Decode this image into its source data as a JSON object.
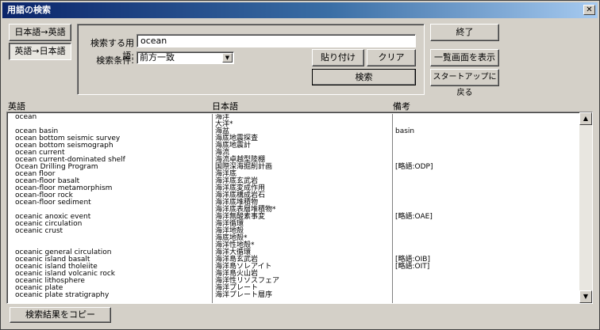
{
  "window": {
    "title": "用語の検索",
    "close_label": "✕"
  },
  "mode_buttons": {
    "ja_to_en": "日本語→英語",
    "en_to_ja": "英語→日本語"
  },
  "search": {
    "term_label": "検索する用語:",
    "term_value": "ocean",
    "condition_label": "検索条件:",
    "condition_value": "前方一致"
  },
  "actions": {
    "paste": "貼り付け",
    "clear": "クリア",
    "search": "検索",
    "exit": "終了",
    "list_view": "一覧画面を表示",
    "back_to_startup": "スタートアップに戻る",
    "copy_results": "検索結果をコピー"
  },
  "columns": {
    "english": "英語",
    "japanese": "日本語",
    "notes": "備考"
  },
  "rows": [
    {
      "en": "ocean",
      "ja": "海洋",
      "note": ""
    },
    {
      "en": "",
      "ja": "大洋*",
      "note": ""
    },
    {
      "en": "ocean basin",
      "ja": "海盆",
      "note": "basin"
    },
    {
      "en": "ocean bottom seismic survey",
      "ja": "海底地震探査",
      "note": ""
    },
    {
      "en": "ocean bottom seismograph",
      "ja": "海底地震計",
      "note": ""
    },
    {
      "en": "ocean current",
      "ja": "海流",
      "note": ""
    },
    {
      "en": "ocean current-dominated shelf",
      "ja": "海流卓越型陸棚",
      "note": ""
    },
    {
      "en": "Ocean Drilling Program",
      "ja": "国際深海掘削計画",
      "note": "[略語:ODP]"
    },
    {
      "en": "ocean floor",
      "ja": "海洋底",
      "note": ""
    },
    {
      "en": "ocean-floor basalt",
      "ja": "海洋底玄武岩",
      "note": ""
    },
    {
      "en": "ocean-floor metamorphism",
      "ja": "海洋底変成作用",
      "note": ""
    },
    {
      "en": "ocean-floor rock",
      "ja": "海洋底構成岩石",
      "note": ""
    },
    {
      "en": "ocean-floor sediment",
      "ja": "海洋底堆積物",
      "note": ""
    },
    {
      "en": "",
      "ja": "海洋底表層堆積物*",
      "note": ""
    },
    {
      "en": "oceanic anoxic event",
      "ja": "海洋無酸素事変",
      "note": "[略語:OAE]"
    },
    {
      "en": "oceanic circulation",
      "ja": "海洋循環",
      "note": ""
    },
    {
      "en": "oceanic crust",
      "ja": "海洋地殻",
      "note": ""
    },
    {
      "en": "",
      "ja": "海底地殻*",
      "note": ""
    },
    {
      "en": "",
      "ja": "海洋性地殻*",
      "note": ""
    },
    {
      "en": "oceanic general circulation",
      "ja": "海洋大循環",
      "note": ""
    },
    {
      "en": "oceanic island basalt",
      "ja": "海洋島玄武岩",
      "note": "[略語:OIB]"
    },
    {
      "en": "oceanic island tholeiite",
      "ja": "海洋島ソレアイト",
      "note": "[略語:OIT]"
    },
    {
      "en": "oceanic island volcanic rock",
      "ja": "海洋島火山岩",
      "note": ""
    },
    {
      "en": "oceanic lithosphere",
      "ja": "海洋性リソスフェア",
      "note": ""
    },
    {
      "en": "oceanic plate",
      "ja": "海洋プレート",
      "note": ""
    },
    {
      "en": "oceanic plate stratigraphy",
      "ja": "海洋プレート層序",
      "note": ""
    }
  ],
  "scrollbar": {
    "up": "▲",
    "down": "▼"
  },
  "select_arrow": "▼"
}
